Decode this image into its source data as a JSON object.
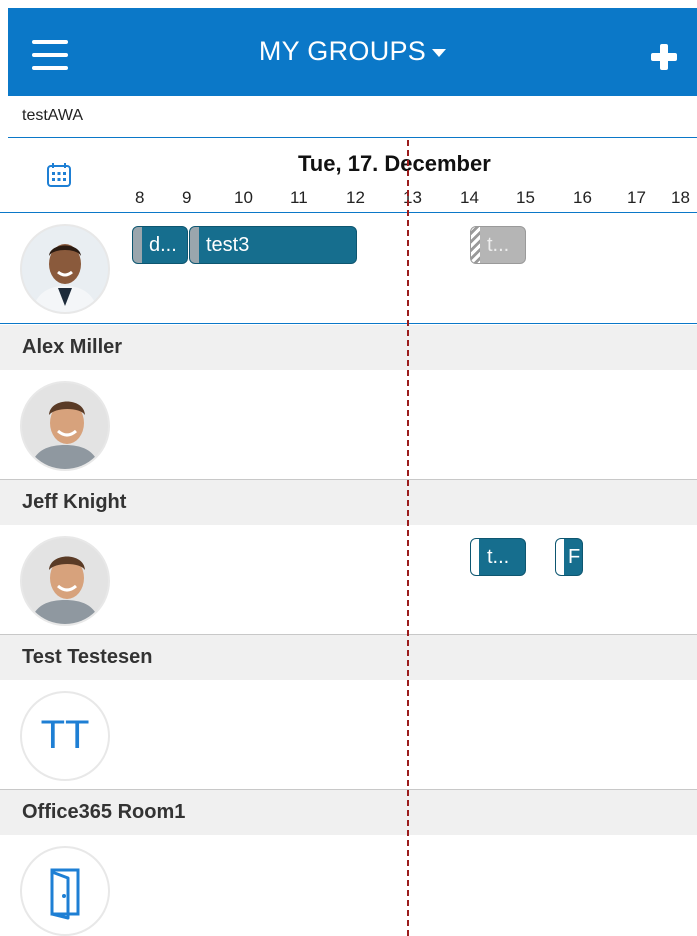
{
  "topbar": {
    "title": "MY GROUPS",
    "menu_icon": "hamburger-menu-icon",
    "add_icon": "plus-icon",
    "accent": "#0b78c8"
  },
  "search": {
    "value": "testAWA"
  },
  "timeline": {
    "date": "Tue, 17. December",
    "calendar_icon": "calendar-icon",
    "hours": [
      "8",
      "9",
      "10",
      "11",
      "12",
      "13",
      "14",
      "15",
      "16",
      "17",
      "18"
    ],
    "now_line_color": "#9b1c1c"
  },
  "me": {
    "events": [
      {
        "label": "d..."
      },
      {
        "label": "test3"
      },
      {
        "label": "t..."
      }
    ]
  },
  "people": [
    {
      "name": "Alex Miller",
      "events": []
    },
    {
      "name": "Jeff Knight",
      "events": [
        {
          "label": "t..."
        },
        {
          "label": "F"
        }
      ]
    },
    {
      "name": "Test Testesen",
      "initials": "TT",
      "events": []
    },
    {
      "name": "Office365 Room1",
      "avatar_icon": "door-icon",
      "events": []
    }
  ],
  "colors": {
    "event": "#166e8e",
    "tentative": "#b5b5b5",
    "initials": "#1e7fd4"
  }
}
